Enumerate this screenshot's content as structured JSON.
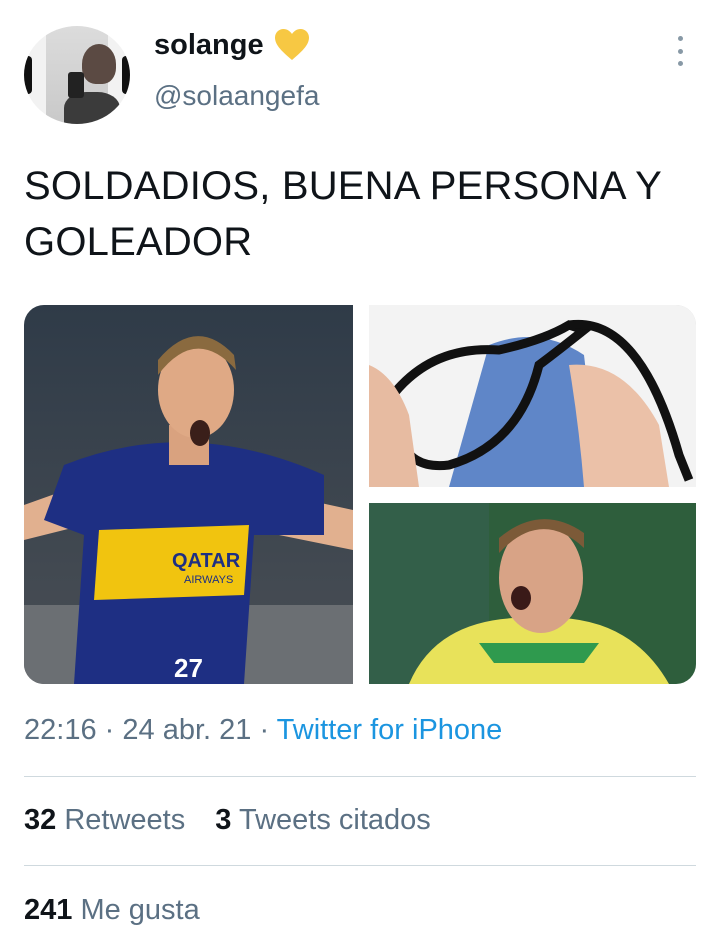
{
  "tweet": {
    "author": {
      "display_name": "solange",
      "handle": "@solaangefa",
      "badge_icon": "yellow-heart-icon",
      "badge_color": "#f7c843"
    },
    "text": "SOLDADIOS, BUENA PERSONA Y GOLEADOR",
    "media": [
      {
        "kind": "photo",
        "description_icon": "soccer-player-celebrating"
      },
      {
        "kind": "photo",
        "description_icon": "glasses-cleaning-cloth"
      },
      {
        "kind": "photo",
        "description_icon": "goalkeeper-shouting"
      }
    ],
    "jersey_text": {
      "sponsor_line1": "QATAR",
      "sponsor_line2": "AIRWAYS",
      "number": "27"
    },
    "time": "22:16",
    "separator": "·",
    "date": "24 abr. 21",
    "source": "Twitter for iPhone",
    "source_color": "#1b95e0",
    "stats": {
      "retweets_count": "32",
      "retweets_label": "Retweets",
      "quotes_count": "3",
      "quotes_label": "Tweets citados",
      "likes_count": "241",
      "likes_label": "Me gusta"
    }
  }
}
